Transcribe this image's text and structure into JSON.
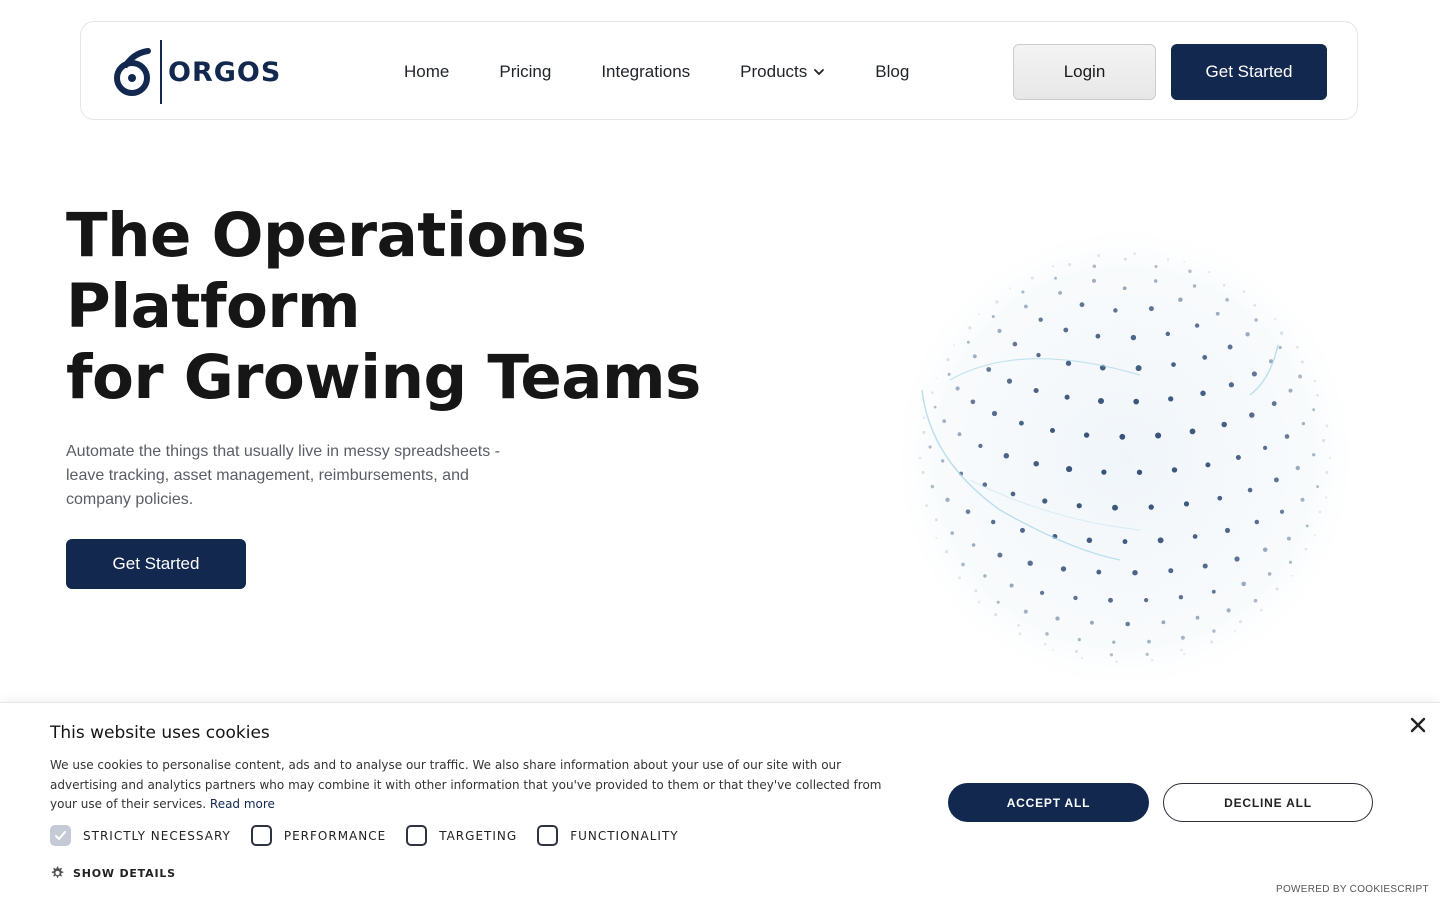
{
  "nav": {
    "logo_text": "ORGOS",
    "links": [
      "Home",
      "Pricing",
      "Integrations",
      "Products",
      "Blog"
    ],
    "login": "Login",
    "get_started": "Get Started",
    "brand_color": "#12284f"
  },
  "hero": {
    "title_lines": [
      "The Operations",
      "Platform",
      "for Growing Teams"
    ],
    "subtitle": "Automate the things that usually live in messy spreadsheets - leave tracking, asset management, reimbursements, and company policies.",
    "cta": "Get Started"
  },
  "cookie": {
    "title": "This website uses cookies",
    "body": "We use cookies to personalise content, ads and to analyse our traffic. We also share information about your use of our site with our advertising and analytics partners who may combine it with other information that you've provided to them or that they've collected from your use of their services.",
    "read_more": "Read more",
    "options": [
      {
        "label": "STRICTLY NECESSARY",
        "checked": true,
        "disabled": true
      },
      {
        "label": "PERFORMANCE",
        "checked": false
      },
      {
        "label": "TARGETING",
        "checked": false
      },
      {
        "label": "FUNCTIONALITY",
        "checked": false
      }
    ],
    "show_details": "SHOW DETAILS",
    "accept": "ACCEPT ALL",
    "decline": "DECLINE ALL",
    "powered_by": "POWERED BY COOKIESCRIPT"
  }
}
